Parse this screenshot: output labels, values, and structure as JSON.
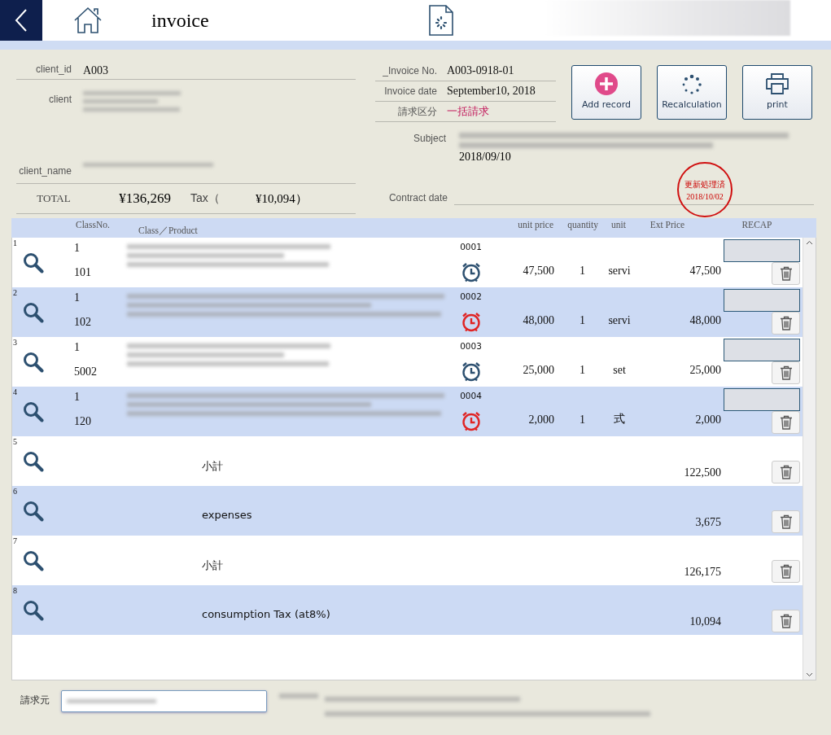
{
  "topbar": {
    "title": "invoice"
  },
  "client": {
    "fields": [
      {
        "label": "client_id",
        "value": "A003"
      },
      {
        "label": "client"
      },
      {
        "label": "client_name"
      }
    ],
    "total_label": "TOTAL",
    "total": "¥136,269",
    "tax_open": "Tax（",
    "tax": "¥10,094",
    "tax_close": "）"
  },
  "invoice": {
    "fields": [
      {
        "label": "_Invoice No.",
        "value": "A003-0918-01",
        "accent": false
      },
      {
        "label": "Invoice date",
        "value": "September10, 2018",
        "accent": false
      },
      {
        "label": "請求区分",
        "value": "一括請求",
        "accent": true
      }
    ]
  },
  "subject": {
    "label": "Subject",
    "date": "2018/09/10"
  },
  "contract": {
    "label": "Contract date"
  },
  "stamp": {
    "title": "更新処理済",
    "date": "2018/10/02"
  },
  "buttons": [
    {
      "label": "Add record"
    },
    {
      "label": "Recalculation"
    },
    {
      "label": "print"
    }
  ],
  "table": {
    "columns": [
      "ClassNo.",
      "Class／Product",
      "unit price",
      "quantity",
      "unit",
      "Ext Price",
      "RECAP"
    ],
    "rows": [
      {
        "kind": "item",
        "number": "1",
        "class_no": "1",
        "code": "101",
        "item_no": "0001",
        "alarm": false,
        "unit_price": "47,500",
        "quantity": "1",
        "unit": "servi",
        "ext_price": "47,500"
      },
      {
        "kind": "item",
        "number": "2",
        "class_no": "1",
        "code": "102",
        "item_no": "0002",
        "alarm": true,
        "unit_price": "48,000",
        "quantity": "1",
        "unit": "servi",
        "ext_price": "48,000"
      },
      {
        "kind": "item",
        "number": "3",
        "class_no": "1",
        "code": "5002",
        "item_no": "0003",
        "alarm": false,
        "unit_price": "25,000",
        "quantity": "1",
        "unit": "set",
        "ext_price": "25,000"
      },
      {
        "kind": "item",
        "number": "4",
        "class_no": "1",
        "code": "120",
        "item_no": "0004",
        "alarm": true,
        "unit_price": "2,000",
        "quantity": "1",
        "unit": "式",
        "ext_price": "2,000"
      },
      {
        "kind": "summary",
        "number": "5",
        "label": "小計",
        "amount": "122,500"
      },
      {
        "kind": "summary",
        "number": "6",
        "label": "expenses",
        "amount": "3,675"
      },
      {
        "kind": "summary",
        "number": "7",
        "label": "小計",
        "amount": "126,175"
      },
      {
        "kind": "summary",
        "number": "8",
        "label": "consumption Tax (at8%)",
        "amount": "10,094"
      }
    ]
  },
  "footer": {
    "label": "請求元"
  }
}
